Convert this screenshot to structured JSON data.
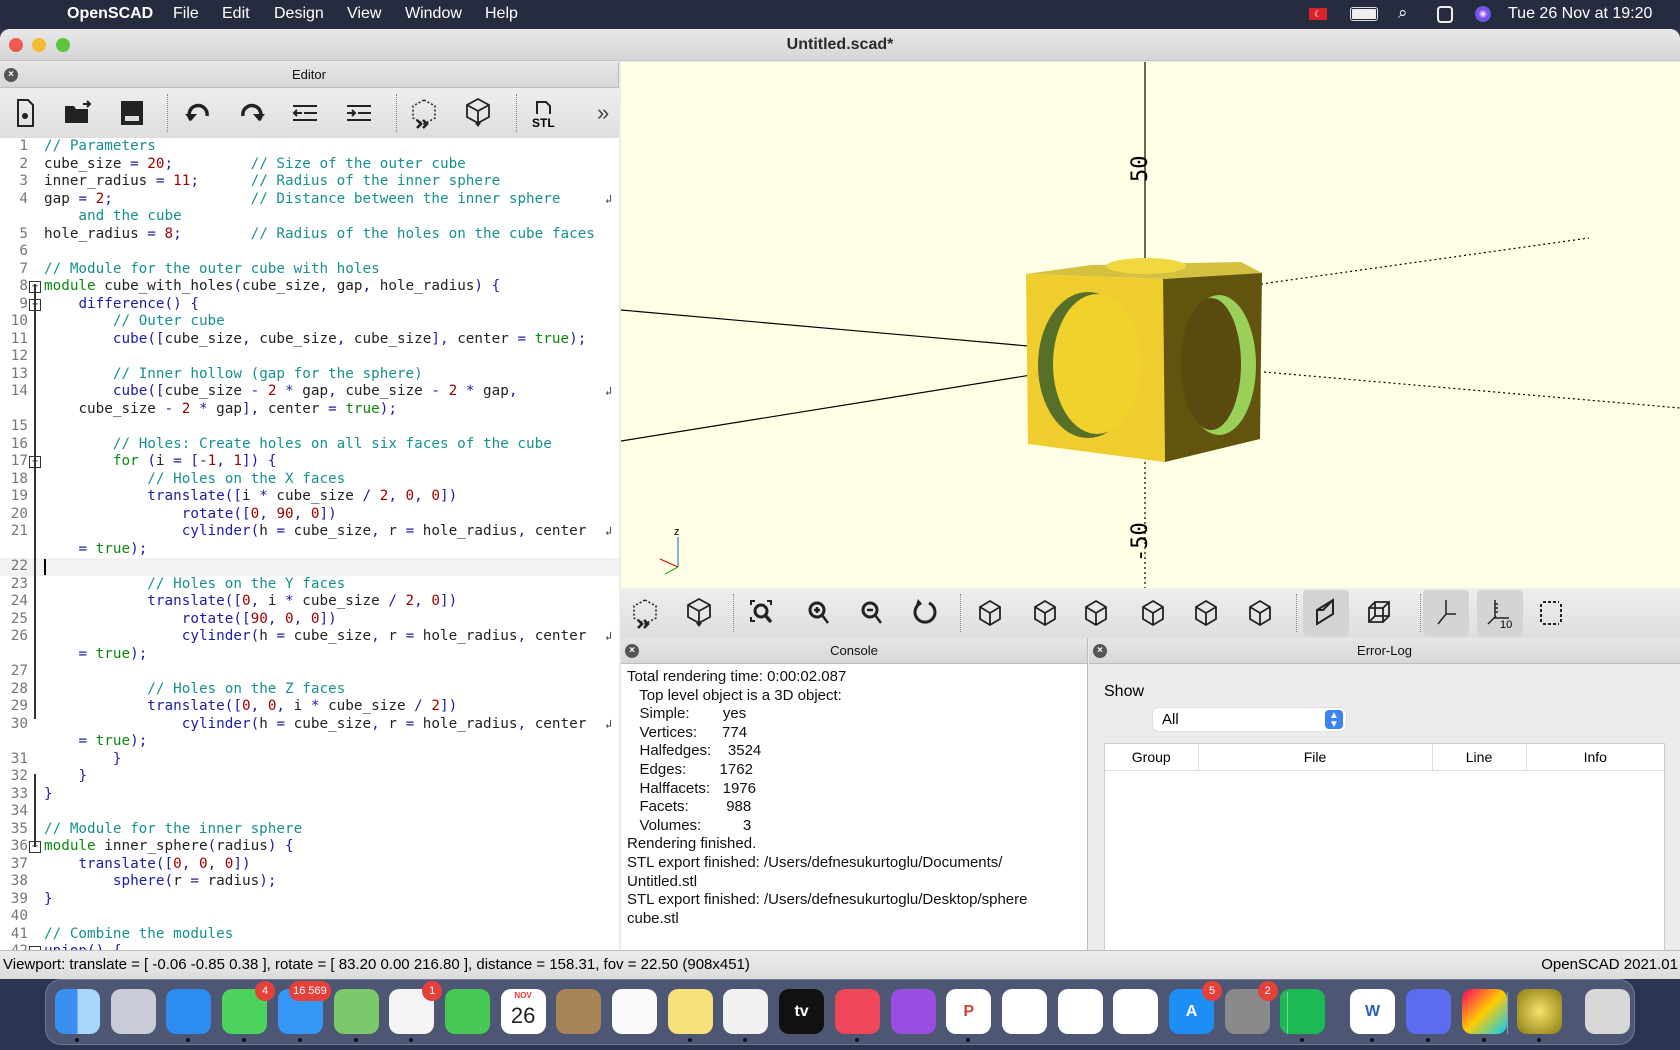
{
  "menubar": {
    "app": "OpenSCAD",
    "items": [
      "File",
      "Edit",
      "Design",
      "View",
      "Window",
      "Help"
    ],
    "clock": "Tue 26 Nov at  19:20",
    "status_icons": [
      "turkish-flag-icon",
      "battery-icon",
      "spotlight-search-icon",
      "control-center-icon",
      "siri-icon"
    ]
  },
  "window": {
    "title": "Untitled.scad*"
  },
  "editor": {
    "title": "Editor",
    "toolbar": [
      "new-file",
      "open-file",
      "save-file",
      "undo",
      "redo",
      "unindent",
      "indent",
      "preview",
      "render",
      "export-stl",
      "more"
    ],
    "stl_label": "STL",
    "more_label": "»",
    "lines": [
      {
        "n": "1",
        "t": "// Parameters"
      },
      {
        "n": "2",
        "t": "cube_size = 20;         // Size of the outer cube"
      },
      {
        "n": "3",
        "t": "inner_radius = 11;      // Radius of the inner sphere"
      },
      {
        "n": "4",
        "t": "gap = 2;                // Distance between the inner sphere",
        "wrap": true
      },
      {
        "n": "",
        "t": "    and the cube",
        "comment": true
      },
      {
        "n": "5",
        "t": "hole_radius = 8;        // Radius of the holes on the cube faces"
      },
      {
        "n": "6",
        "t": ""
      },
      {
        "n": "7",
        "t": "// Module for the outer cube with holes"
      },
      {
        "n": "8",
        "t": "module cube_with_holes(cube_size, gap, hole_radius) {",
        "fold": true
      },
      {
        "n": "9",
        "t": "    difference() {",
        "fold": true
      },
      {
        "n": "10",
        "t": "        // Outer cube"
      },
      {
        "n": "11",
        "t": "        cube([cube_size, cube_size, cube_size], center = true);"
      },
      {
        "n": "12",
        "t": ""
      },
      {
        "n": "13",
        "t": "        // Inner hollow (gap for the sphere)"
      },
      {
        "n": "14",
        "t": "        cube([cube_size - 2 * gap, cube_size - 2 * gap,",
        "wrap": true
      },
      {
        "n": "",
        "t": "    cube_size - 2 * gap], center = true);"
      },
      {
        "n": "15",
        "t": ""
      },
      {
        "n": "16",
        "t": "        // Holes: Create holes on all six faces of the cube"
      },
      {
        "n": "17",
        "t": "        for (i = [-1, 1]) {",
        "fold": true
      },
      {
        "n": "18",
        "t": "            // Holes on the X faces"
      },
      {
        "n": "19",
        "t": "            translate([i * cube_size / 2, 0, 0])"
      },
      {
        "n": "20",
        "t": "                rotate([0, 90, 0])"
      },
      {
        "n": "21",
        "t": "                cylinder(h = cube_size, r = hole_radius, center",
        "wrap": true
      },
      {
        "n": "",
        "t": "    = true);"
      },
      {
        "n": "22",
        "t": "",
        "current": true
      },
      {
        "n": "23",
        "t": "            // Holes on the Y faces"
      },
      {
        "n": "24",
        "t": "            translate([0, i * cube_size / 2, 0])"
      },
      {
        "n": "25",
        "t": "                rotate([90, 0, 0])"
      },
      {
        "n": "26",
        "t": "                cylinder(h = cube_size, r = hole_radius, center",
        "wrap": true
      },
      {
        "n": "",
        "t": "    = true);"
      },
      {
        "n": "27",
        "t": ""
      },
      {
        "n": "28",
        "t": "            // Holes on the Z faces"
      },
      {
        "n": "29",
        "t": "            translate([0, 0, i * cube_size / 2])"
      },
      {
        "n": "30",
        "t": "                cylinder(h = cube_size, r = hole_radius, center",
        "wrap": true
      },
      {
        "n": "",
        "t": "    = true);"
      },
      {
        "n": "31",
        "t": "        }"
      },
      {
        "n": "32",
        "t": "    }"
      },
      {
        "n": "33",
        "t": "}"
      },
      {
        "n": "34",
        "t": ""
      },
      {
        "n": "35",
        "t": "// Module for the inner sphere"
      },
      {
        "n": "36",
        "t": "module inner_sphere(radius) {",
        "fold": true
      },
      {
        "n": "37",
        "t": "    translate([0, 0, 0])"
      },
      {
        "n": "38",
        "t": "        sphere(r = radius);"
      },
      {
        "n": "39",
        "t": "}"
      },
      {
        "n": "40",
        "t": ""
      },
      {
        "n": "41",
        "t": "// Combine the modules"
      },
      {
        "n": "42",
        "t": "union() {",
        "fold": true
      }
    ]
  },
  "viewport": {
    "axis_labels": [
      "50",
      "-50"
    ],
    "axis_indicator": "z",
    "model_color": "#f0d030",
    "toolbar": [
      "preview",
      "render",
      "view-all",
      "zoom-in",
      "zoom-out",
      "reset-view",
      "view-right",
      "view-top",
      "view-bottom",
      "view-left",
      "view-front",
      "view-back",
      "perspective",
      "orthogonal",
      "show-axes",
      "show-scale-markers",
      "show-edges"
    ],
    "active": [
      "perspective",
      "show-axes",
      "show-scale-markers"
    ],
    "scale_label": "10"
  },
  "console": {
    "title": "Console",
    "lines": [
      "Total rendering time: 0:00:02.087",
      "   Top level object is a 3D object:",
      "   Simple:        yes",
      "   Vertices:      774",
      "   Halfedges:    3524",
      "   Edges:        1762",
      "   Halffacets:   1976",
      "   Facets:         988",
      "   Volumes:          3",
      "Rendering finished.",
      "STL export finished: /Users/defnesukurtoglu/Documents/",
      "Untitled.stl",
      "STL export finished: /Users/defnesukurtoglu/Desktop/sphere",
      "cube.stl"
    ]
  },
  "errorlog": {
    "title": "Error-Log",
    "show_label": "Show",
    "show_value": "All",
    "columns": [
      "Group",
      "File",
      "Line",
      "Info"
    ]
  },
  "statusbar": {
    "viewport": "Viewport: translate = [ -0.06 -0.85 0.38 ], rotate = [ 83.20 0.00 216.80 ], distance = 158.31, fov = 22.50 (908x451)",
    "version": "OpenSCAD 2021.01"
  },
  "dock": [
    {
      "name": "finder",
      "bg": "linear-gradient(90deg,#3b8ff0 50%,#a9d4fb 50%)",
      "dot": true
    },
    {
      "name": "launchpad",
      "bg": "#c9ccd6"
    },
    {
      "name": "safari",
      "bg": "#2d8cf0",
      "dot": true
    },
    {
      "name": "messages",
      "bg": "#4bd35d",
      "badge": "4",
      "dot": true
    },
    {
      "name": "mail",
      "bg": "#3497f7",
      "badge": "16 569",
      "dot": true
    },
    {
      "name": "maps",
      "bg": "#7cc96b",
      "dot": true
    },
    {
      "name": "photos",
      "bg": "#f4f4f4",
      "badge": "1",
      "dot": true
    },
    {
      "name": "facetime",
      "bg": "#48c955"
    },
    {
      "name": "calendar",
      "bg": "#fff",
      "label": "26",
      "dot": false
    },
    {
      "name": "contacts",
      "bg": "#a88456"
    },
    {
      "name": "reminders",
      "bg": "#fafafa"
    },
    {
      "name": "notes",
      "bg": "#f8e07a",
      "dot": true
    },
    {
      "name": "chrome",
      "bg": "#f1f1f1",
      "dot": true
    },
    {
      "name": "apple-tv",
      "bg": "#111",
      "label": "tv"
    },
    {
      "name": "music",
      "bg": "#f0485a",
      "dot": true
    },
    {
      "name": "podcasts",
      "bg": "#9a4de0"
    },
    {
      "name": "powerpoint",
      "bg": "#fff",
      "label": "P",
      "dot": true
    },
    {
      "name": "keynote",
      "bg": "#fff"
    },
    {
      "name": "numbers",
      "bg": "#fff"
    },
    {
      "name": "pages",
      "bg": "#fff"
    },
    {
      "name": "app-store",
      "bg": "#1c8ef5",
      "badge": "5",
      "label": "A"
    },
    {
      "name": "system-preferences",
      "bg": "#8a8a8a",
      "badge": "2"
    },
    {
      "name": "spotify",
      "bg": "#1db954",
      "dot": true
    },
    {
      "name": "word",
      "bg": "#fff",
      "label": "W",
      "dot": true
    },
    {
      "name": "player-app",
      "bg": "#5b6cf0",
      "dot": true
    },
    {
      "name": "utility-app",
      "bg": "linear-gradient(135deg,#f06,#fc0,#0cf)",
      "dot": true
    },
    {
      "name": "openscad",
      "bg": "radial-gradient(#f4e26a,#8a7a10)",
      "dot": true
    },
    {
      "name": "trash",
      "bg": "#d8d8d8"
    }
  ],
  "dock_calendar_month": "NOV"
}
